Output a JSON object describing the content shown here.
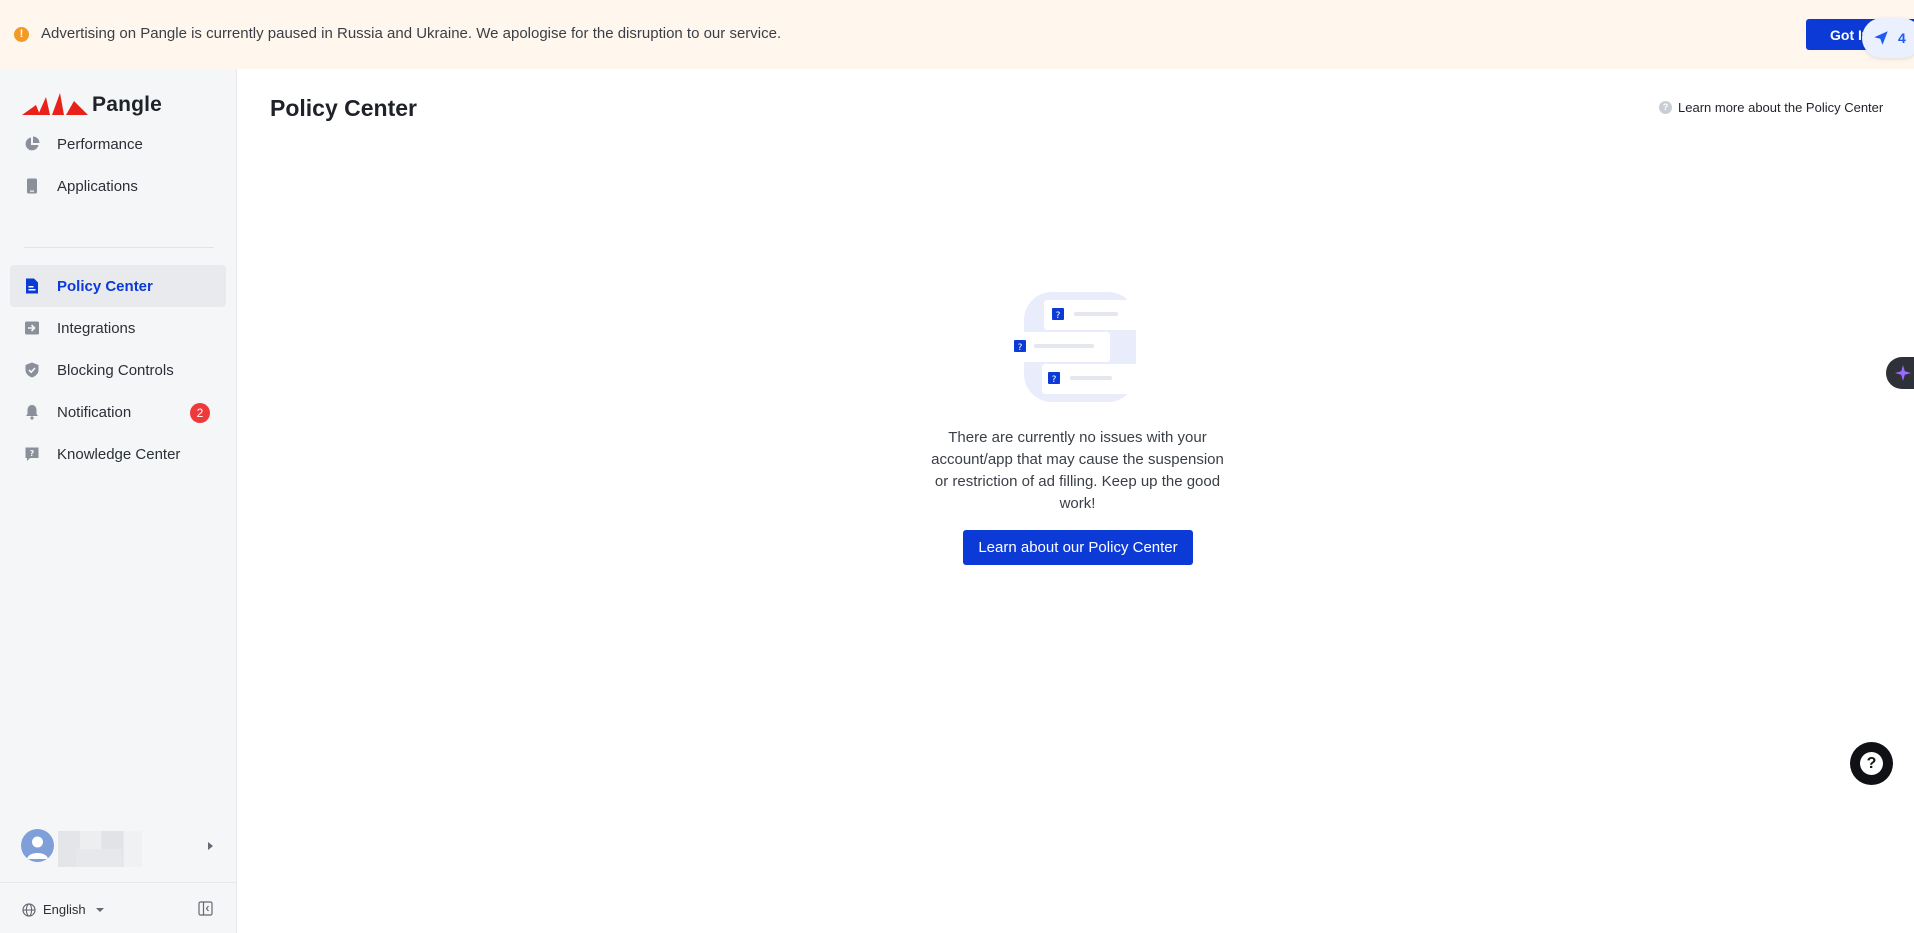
{
  "banner": {
    "message": "Advertising on Pangle is currently paused in Russia and Ukraine. We apologise for the disruption to our service.",
    "dismiss_label": "Got It",
    "floating_count": "4"
  },
  "brand": {
    "name": "Pangle",
    "logo_color": "#e8221b"
  },
  "sidebar": {
    "items": [
      {
        "label": "Performance",
        "icon": "pie-chart-icon"
      },
      {
        "label": "Applications",
        "icon": "phone-icon"
      },
      {
        "label": "Policy Center",
        "icon": "document-icon",
        "active": true
      },
      {
        "label": "Integrations",
        "icon": "import-icon"
      },
      {
        "label": "Blocking Controls",
        "icon": "shield-icon"
      },
      {
        "label": "Notification",
        "icon": "bell-icon",
        "badge": "2"
      },
      {
        "label": "Knowledge Center",
        "icon": "help-book-icon"
      }
    ],
    "language": "English"
  },
  "main": {
    "title": "Policy Center",
    "learn_more_label": "Learn more about the Policy Center",
    "empty_state": {
      "message": "There are currently no issues with your account/app that may cause the suspension or restriction of ad filling. Keep up the good work!",
      "cta_label": "Learn about our Policy Center"
    }
  },
  "colors": {
    "accent": "#0b3ad6",
    "banner_bg": "#fff7ed",
    "warning": "#f29a24",
    "badge": "#ee3a3a",
    "sidebar_bg": "#f5f6f7"
  }
}
